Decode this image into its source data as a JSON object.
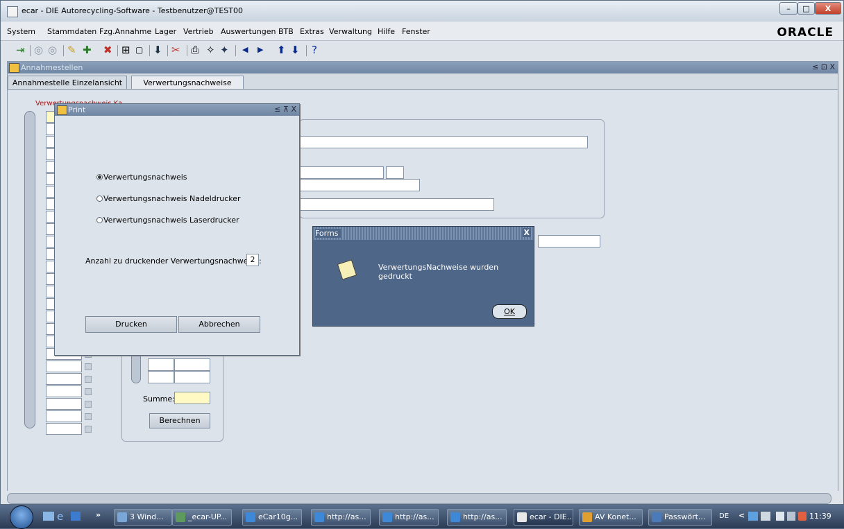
{
  "window": {
    "title": "ecar - DIE Autorecycling-Software - Testbenutzer@TEST00"
  },
  "caption_buttons": {
    "minimize": "–",
    "maximize": "□",
    "close": "X"
  },
  "menu": {
    "items": [
      "System",
      "Stammdaten",
      "Fzg.Annahme",
      "Lager",
      "Vertrieb",
      "Auswertungen",
      "BTB",
      "Extras",
      "Verwaltung",
      "Hilfe",
      "Fenster"
    ],
    "brand": "ORACLE"
  },
  "toolbar_icons": [
    "exit-icon",
    "circle-back-icon",
    "circle-forward-icon",
    "pencil-icon",
    "insert-record-icon",
    "delete-record-icon",
    "clear-icon",
    "block-icon",
    "download-icon",
    "edit-icon",
    "print-icon",
    "query-icon",
    "query-run-icon",
    "prev-icon",
    "next-icon",
    "up-icon",
    "down-icon",
    "help-icon"
  ],
  "child": {
    "title": "Annahmestellen",
    "controls": "≤ ⊡ X",
    "tabs": [
      "Annahmestelle Einzelansicht",
      "Verwertungsnachweise"
    ],
    "grid_header": "Verwertungsnachweis  Ka",
    "summe_label": "Summe:",
    "berechnen": "Berechnen"
  },
  "print_dialog": {
    "title": "Print",
    "controls": "≤ ⊼ X",
    "options": [
      {
        "label": "Verwertungsnachweis",
        "selected": true
      },
      {
        "label": "Verwertungsnachweis Nadeldrucker",
        "selected": false
      },
      {
        "label": "Verwertungsnachweis Laserdrucker",
        "selected": false
      }
    ],
    "count_label": "Anzahl zu druckender Verwertungsnachweise:",
    "count_value": "2",
    "print_button": "Drucken",
    "cancel_button": "Abbrechen"
  },
  "forms_dialog": {
    "title": "Forms",
    "message": "VerwertungsNachweise wurden gedruckt",
    "ok": "OK",
    "close": "X"
  },
  "taskbar": {
    "chevron": "»",
    "buttons": [
      "3 Wind...",
      "_ecar-UP...",
      "eCar10g...",
      "http://as...",
      "http://as...",
      "http://as...",
      "ecar - DIE...",
      "AV Konet...",
      "Passwört..."
    ],
    "lang": "DE",
    "tray_arrow": "<",
    "time": "11:39"
  },
  "colors": {
    "accent_title": "#6f86a3",
    "forms_bg": "#4e6688",
    "required_field": "#fff9c4"
  }
}
